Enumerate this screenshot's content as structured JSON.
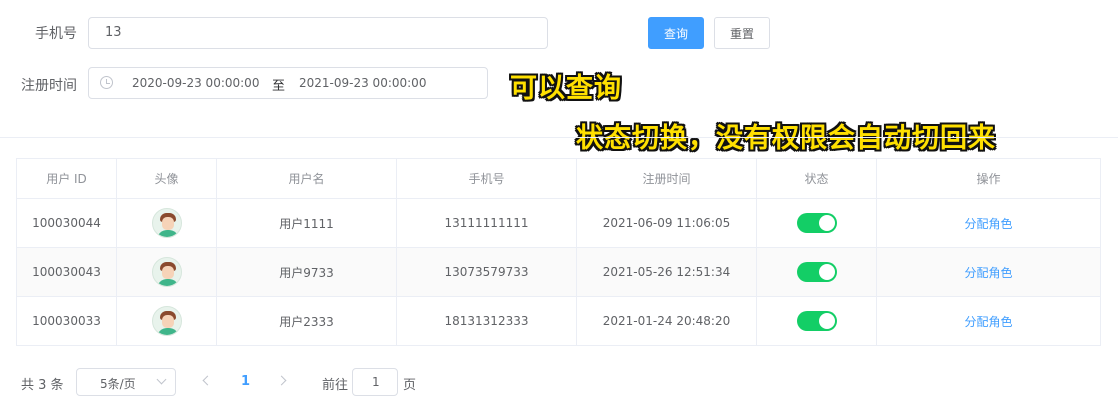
{
  "search": {
    "phone_label": "手机号",
    "phone_value": "13",
    "regtime_label": "注册时间",
    "date_start": "2020-09-23 00:00:00",
    "date_separator": "至",
    "date_end": "2021-09-23 00:00:00",
    "query_button": "查询",
    "reset_button": "重置"
  },
  "annotations": {
    "line1": "可以查询",
    "line2": "状态切换，没有权限会自动切回来"
  },
  "table": {
    "headers": [
      "用户 ID",
      "头像",
      "用户名",
      "手机号",
      "注册时间",
      "状态",
      "操作"
    ],
    "rows": [
      {
        "id": "100030044",
        "username": "用户1111",
        "phone": "13111111111",
        "regtime": "2021-06-09 11:06:05",
        "status": true,
        "action": "分配角色"
      },
      {
        "id": "100030043",
        "username": "用户9733",
        "phone": "13073579733",
        "regtime": "2021-05-26 12:51:34",
        "status": true,
        "action": "分配角色"
      },
      {
        "id": "100030033",
        "username": "用户2333",
        "phone": "18131312333",
        "regtime": "2021-01-24 20:48:20",
        "status": true,
        "action": "分配角色"
      }
    ]
  },
  "pagination": {
    "total": "共 3 条",
    "page_size": "5条/页",
    "current_page": "1",
    "goto_label": "前往",
    "goto_value": "1",
    "goto_suffix": "页"
  },
  "colors": {
    "primary": "#409eff",
    "switch_on": "#13ce66",
    "annotation": "#ffe000"
  }
}
